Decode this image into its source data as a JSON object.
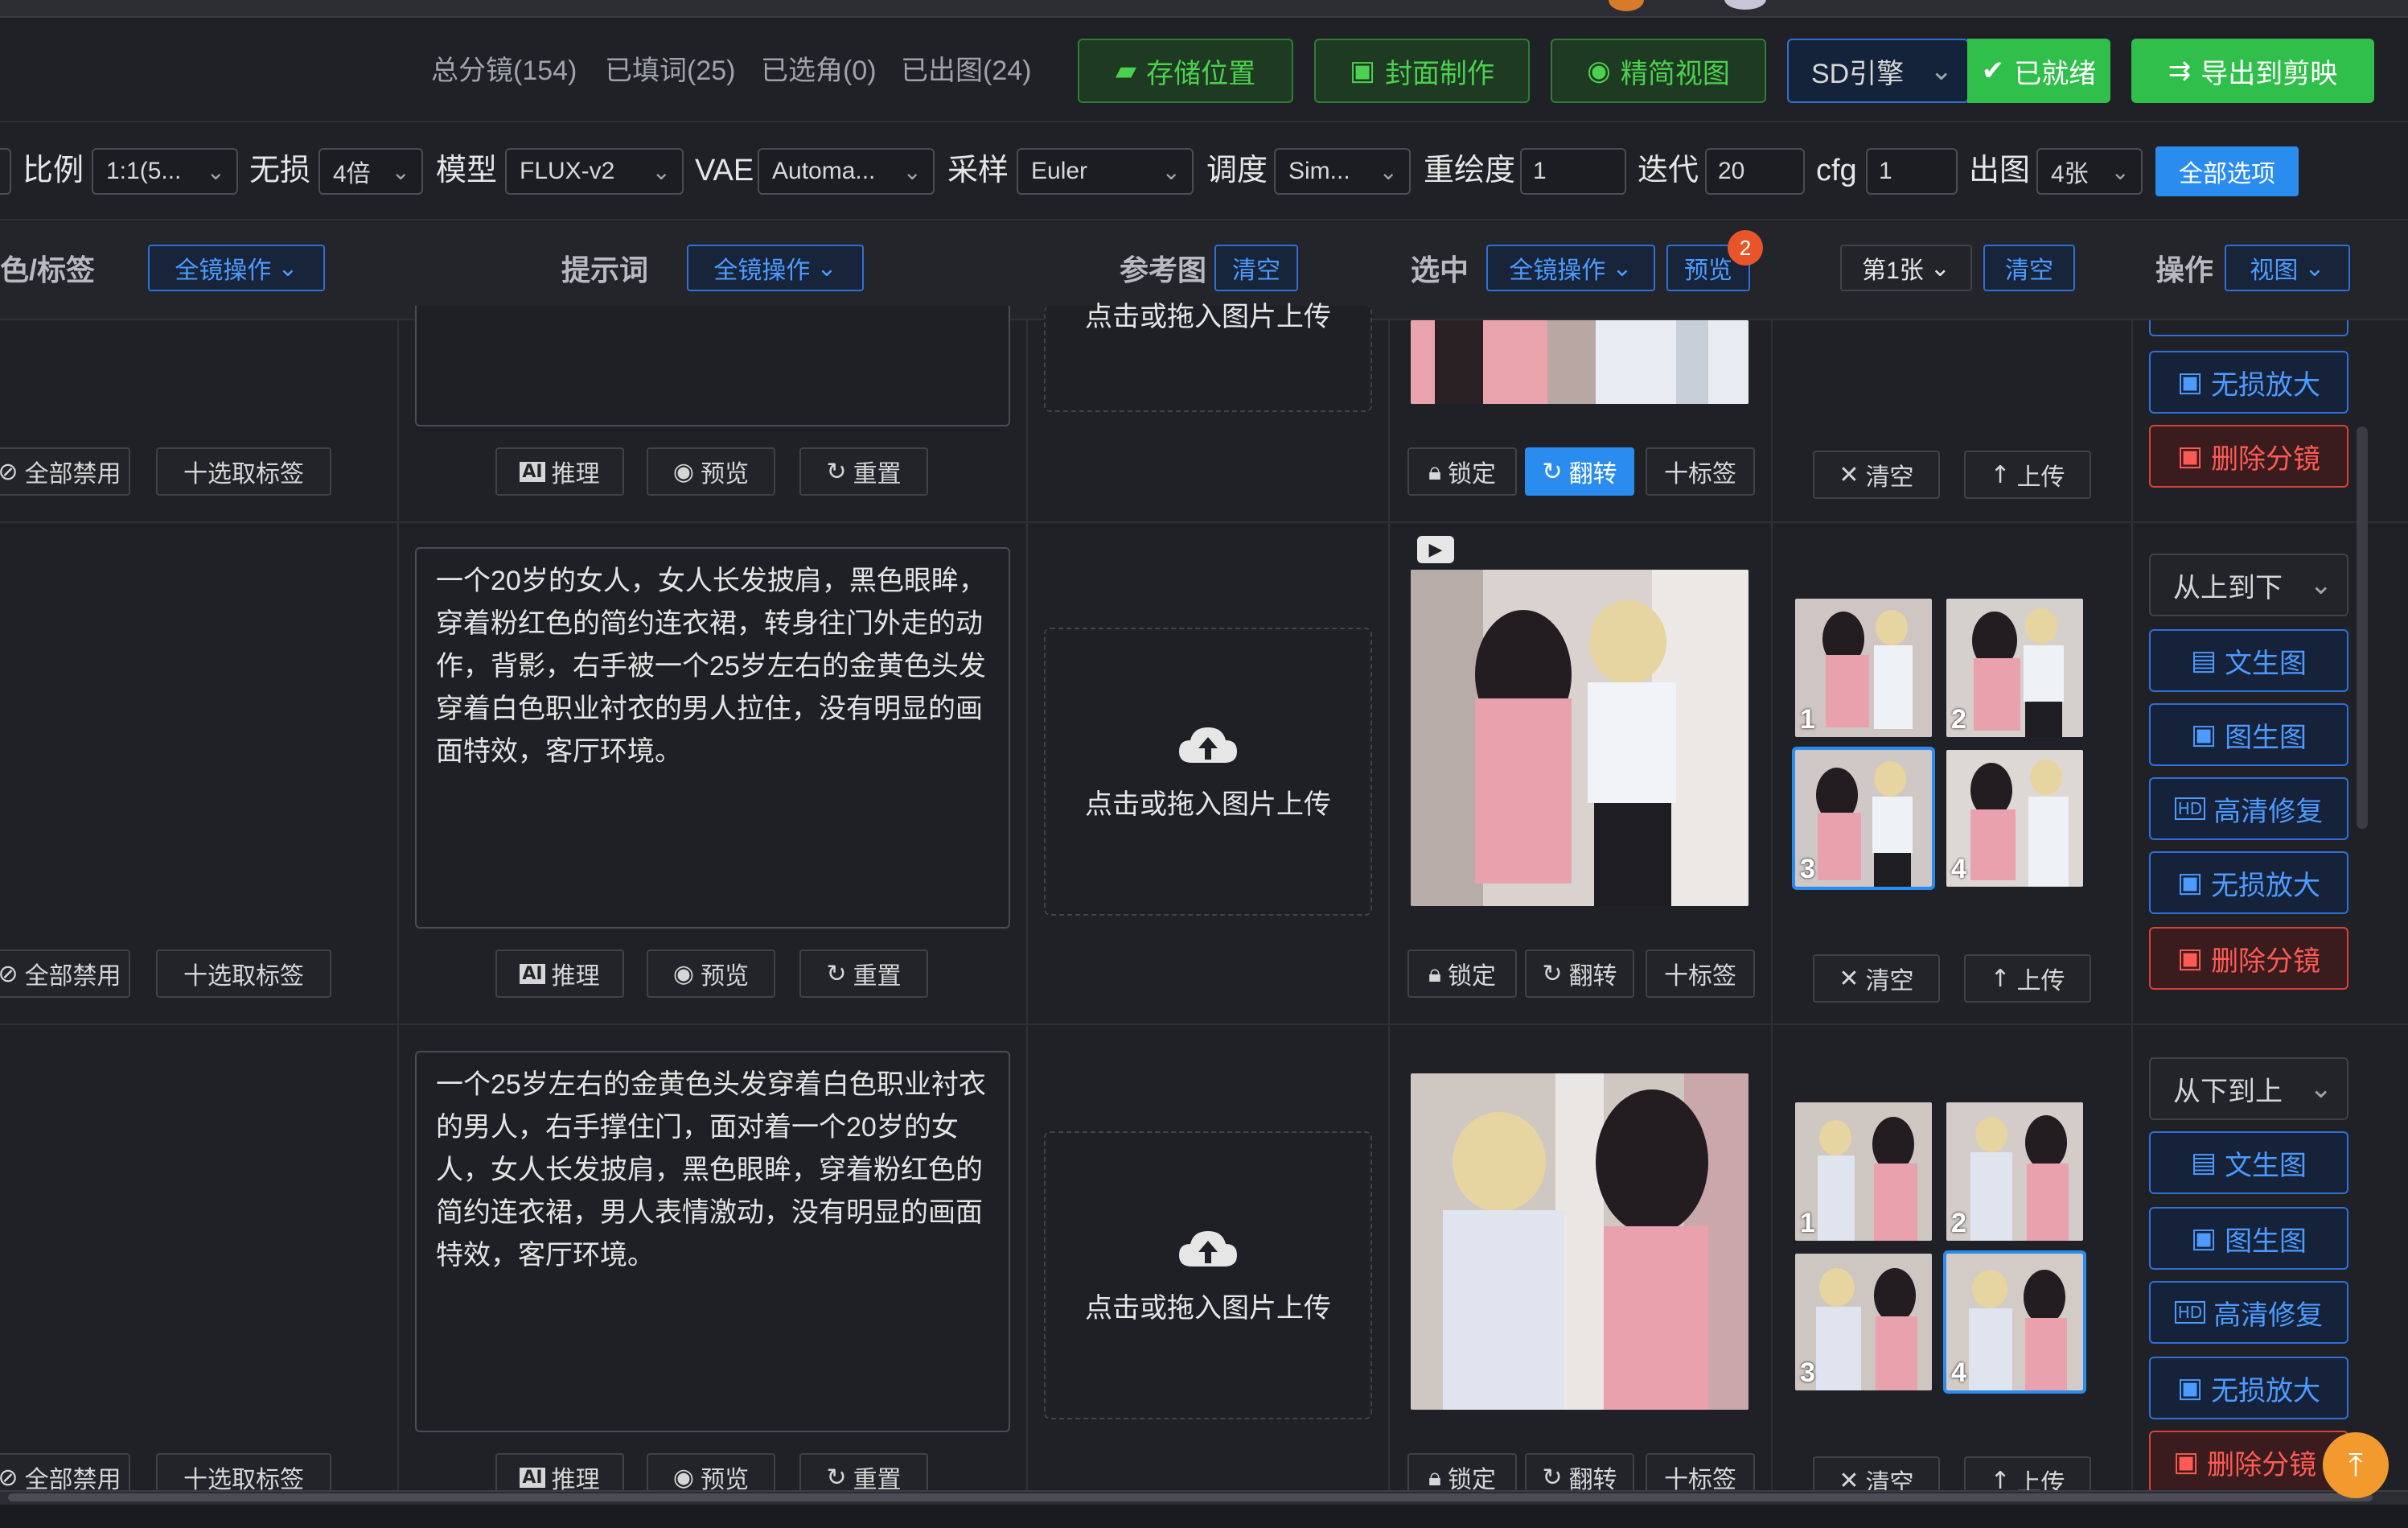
{
  "header": {
    "stats": [
      "总分镜(154)",
      "已填词(25)",
      "已选角(0)",
      "已出图(24)"
    ],
    "btn_storage": "存储位置",
    "btn_cover": "封面制作",
    "btn_view": "精简视图",
    "engine": "SD引擎",
    "btn_ready": "已就绪",
    "btn_export": "导出到剪映"
  },
  "params": {
    "ratio_label": "比例",
    "ratio_value": "1:1(5...",
    "lossless_label": "无损",
    "lossless_value": "4倍",
    "model_label": "模型",
    "model_value": "FLUX-v2",
    "vae_label": "VAE",
    "vae_value": "Automa...",
    "sampler_label": "采样",
    "sampler_value": "Euler",
    "schedule_label": "调度",
    "schedule_value": "Sim...",
    "redraw_label": "重绘度",
    "redraw_value": "1",
    "iter_label": "迭代",
    "iter_value": "20",
    "cfg_label": "cfg",
    "cfg_value": "1",
    "out_label": "出图",
    "out_value": "4张",
    "all_options": "全部选项"
  },
  "thead": {
    "col_tags": "色/标签",
    "tags_op": "全镜操作",
    "col_prompt": "提示词",
    "prompt_op": "全镜操作",
    "col_ref": "参考图",
    "ref_clear": "清空",
    "col_selected": "选中",
    "sel_op": "全镜操作",
    "sel_preview": "预览",
    "sel_badge": "2",
    "which": "第1张",
    "which_clear": "清空",
    "col_ops": "操作",
    "ops_view": "视图"
  },
  "common": {
    "disable_all": "全部禁用",
    "pick_tags": "十选取标签",
    "infer": "推理",
    "preview": "预览",
    "reset": "重置",
    "lock": "锁定",
    "flip": "翻转",
    "tag": "十标签",
    "clear": "清空",
    "upload": "上传",
    "upload_hint": "点击或拖入图片上传",
    "upload_hint_cut": "点击或拖入图片上传",
    "txt2img": "文生图",
    "img2img": "图生图",
    "hd_fix": "高清修复",
    "lossless_up": "无损放大",
    "delete_shot": "删除分镜"
  },
  "rows": [
    {
      "prompt": "一个20岁的女人，女人长发披肩，黑色眼眸，穿着粉红色的简约连衣裙，转身往门外走的动作，背影，右手被一个25岁左右的金黄色头发穿着白色职业衬衣的男人拉住，没有明显的画面特效，客厅环境。",
      "order": "从上到下",
      "thumbs": [
        "1",
        "2",
        "3",
        "4"
      ]
    },
    {
      "prompt": "一个25岁左右的金黄色头发穿着白色职业衬衣的男人，右手撑住门，面对着一个20岁的女人，女人长发披肩，黑色眼眸，穿着粉红色的简约连衣裙，男人表情激动，没有明显的画面特效，客厅环境。",
      "order": "从下到上",
      "thumbs": [
        "1",
        "2",
        "3",
        "4"
      ]
    }
  ]
}
